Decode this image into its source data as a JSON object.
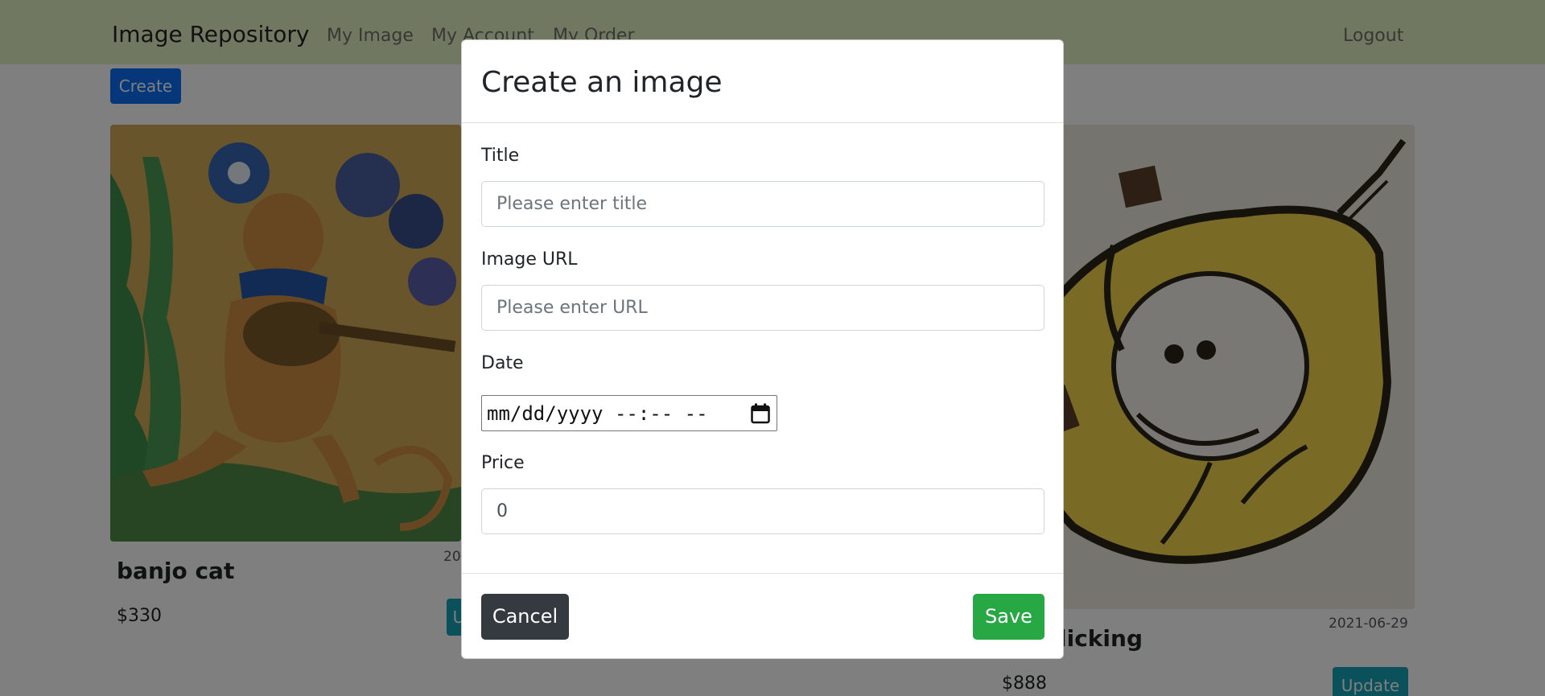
{
  "navbar": {
    "brand": "Image Repository",
    "links": [
      "My Image",
      "My Account",
      "My Order"
    ],
    "logout": "Logout"
  },
  "toolbar": {
    "create_label": "Create"
  },
  "cards": [
    {
      "title": "banjo cat",
      "price": "$330",
      "date": "20",
      "update_label": "U"
    },
    {
      "title": "licking",
      "price": "$888",
      "date": "2021-06-29",
      "update_label": "Update"
    }
  ],
  "modal": {
    "title": "Create an image",
    "fields": {
      "title_label": "Title",
      "title_placeholder": "Please enter title",
      "url_label": "Image URL",
      "url_placeholder": "Please enter URL",
      "date_label": "Date",
      "date_value": "mm/dd/yyyy --:-- --",
      "price_label": "Price",
      "price_value": "0"
    },
    "cancel_label": "Cancel",
    "save_label": "Save"
  },
  "colors": {
    "navbar_bg": "#e3f1c5",
    "primary": "#0a6ef5",
    "info": "#17a2b8",
    "dark": "#343a40",
    "success": "#28a745"
  }
}
